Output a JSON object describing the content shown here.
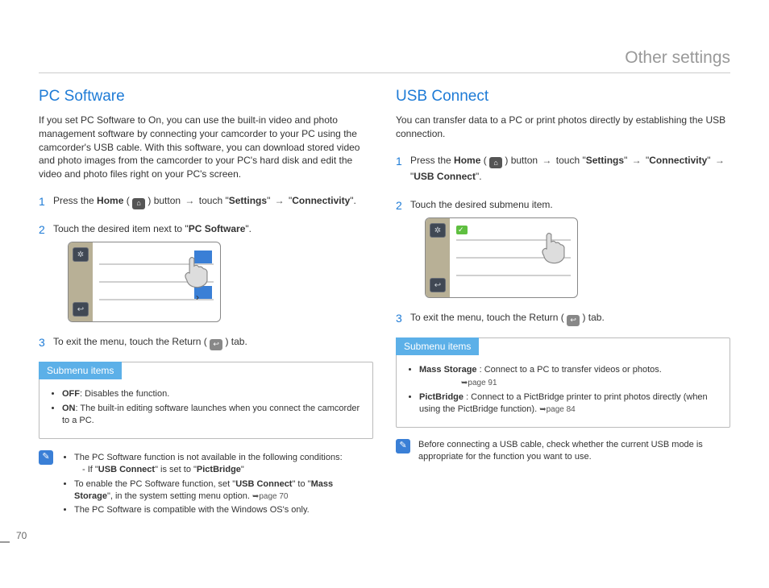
{
  "header": {
    "title": "Other settings"
  },
  "page_number": "70",
  "left": {
    "heading": "PC Software",
    "intro": "If you set PC Software to On, you can use the built-in video and photo management software by connecting your camcorder to your PC using the camcorder's USB cable. With this software, you can download stored video and photo images from the camcorder to your PC's hard disk and edit the video and photo files right on your PC's screen.",
    "step1_pre": "Press the ",
    "step1_home": "Home",
    "step1_mid": " ( ",
    "step1_post_icon": " ) button ",
    "step1_touch": " touch \"",
    "step1_settings": "Settings",
    "step1_arrow2": "\" ",
    "step1_conn_pre": " \"",
    "step1_conn": "Connectivity",
    "step1_conn_post": "\".",
    "step2_pre": "Touch the desired item next to \"",
    "step2_bold": "PC Software",
    "step2_post": "\".",
    "step3_pre": "To exit the menu, touch the Return ( ",
    "step3_post": " ) tab.",
    "submenu_title": "Submenu items",
    "sub_off_label": "OFF",
    "sub_off_text": ": Disables the function.",
    "sub_on_label": "ON",
    "sub_on_text": ": The built-in editing software launches when you connect the camcorder to a PC.",
    "note1": "The PC Software function is not available in the following conditions:",
    "note1a_pre": "- If \"",
    "note1a_b1": "USB Connect",
    "note1a_mid": "\" is set to \"",
    "note1a_b2": "PictBridge",
    "note1a_post": "\"",
    "note2_pre": "To enable the PC Software function, set \"",
    "note2_b1": "USB Connect",
    "note2_mid": "\" to \"",
    "note2_b2": "Mass Storage",
    "note2_post": "\", in the system setting menu option. ",
    "note2_page": "➥page 70",
    "note3": "The PC Software is compatible with the Windows OS's only."
  },
  "right": {
    "heading": "USB Connect",
    "intro": "You can transfer data to a PC or print photos directly by establishing the USB connection.",
    "step1_pre": "Press the ",
    "step1_home": "Home",
    "step1_mid": " ( ",
    "step1_post_icon": " ) button ",
    "step1_touch": " touch \"",
    "step1_settings": "Settings",
    "step1_arrow2": "\" ",
    "step1_conn_pre": " \"",
    "step1_conn": "Connectivity",
    "step1_conn_post": "\" ",
    "step1_usb_pre": " \"",
    "step1_usb": "USB Connect",
    "step1_usb_post": "\".",
    "step2": "Touch the desired submenu item.",
    "step3_pre": "To exit the menu, touch the Return ( ",
    "step3_post": " ) tab.",
    "submenu_title": "Submenu items",
    "sub_ms_label": "Mass Storage",
    "sub_ms_text": " : Connect to a PC to transfer videos or photos.",
    "sub_ms_page": "➥page 91",
    "sub_pb_label": "PictBridge",
    "sub_pb_text": " : Connect to a PictBridge printer to print photos directly (when using the PictBridge function). ",
    "sub_pb_page": "➥page 84",
    "note": "Before connecting a USB cable, check whether the current USB mode is appropriate for the function you want to use."
  }
}
